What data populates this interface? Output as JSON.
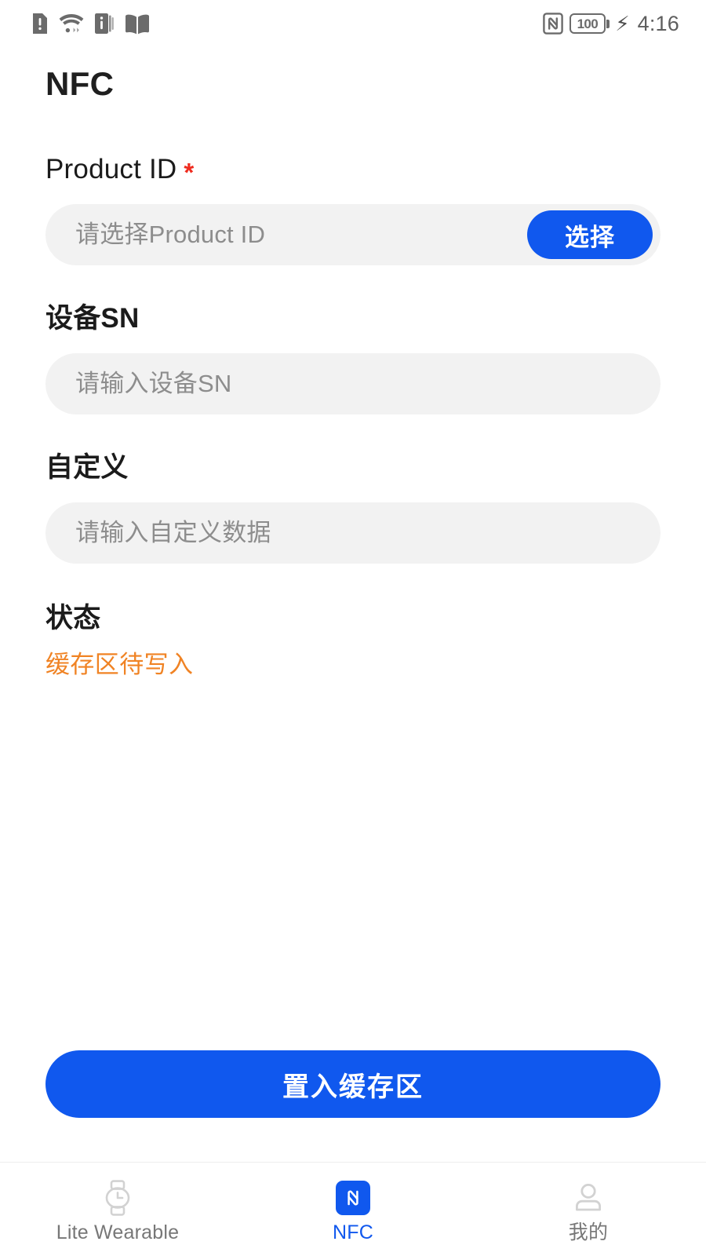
{
  "status_bar": {
    "left_icons": [
      {
        "name": "alert-document-icon"
      },
      {
        "name": "wifi-icon"
      },
      {
        "name": "info-icon"
      },
      {
        "name": "book-icon"
      }
    ],
    "nfc_indicator": "nfc-icon",
    "battery_level": "100",
    "charging_icon": "charging-bolt-icon",
    "time": "4:16"
  },
  "header": {
    "title": "NFC"
  },
  "form": {
    "product_id": {
      "label": "Product ID",
      "required_marker": "*",
      "value": "",
      "placeholder": "请选择Product ID",
      "button_label": "选择"
    },
    "device_sn": {
      "label": "设备SN",
      "value": "",
      "placeholder": "请输入设备SN"
    },
    "custom": {
      "label": "自定义",
      "value": "",
      "placeholder": "请输入自定义数据"
    },
    "status": {
      "label": "状态",
      "value": "缓存区待写入"
    }
  },
  "primary_action": {
    "label": "置入缓存区"
  },
  "tab_bar": {
    "items": [
      {
        "label": "Lite Wearable",
        "icon": "watch-icon",
        "active": false
      },
      {
        "label": "NFC",
        "icon": "nfc-icon",
        "active": true
      },
      {
        "label": "我的",
        "icon": "person-icon",
        "active": false
      }
    ]
  },
  "colors": {
    "accent": "#1058EE",
    "status_warning": "#F08324",
    "required": "#EF2C1F",
    "input_bg": "#F2F2F2",
    "text_primary": "#1B1B1B",
    "placeholder": "#8D8D8D"
  }
}
